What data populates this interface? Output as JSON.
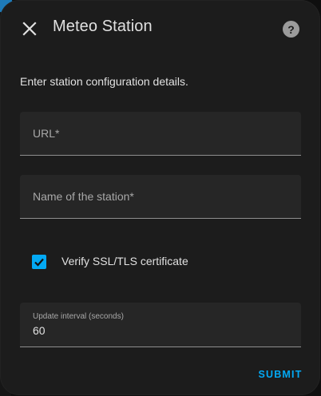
{
  "dialog": {
    "title": "Meteo Station",
    "description": "Enter station configuration details.",
    "close_icon": "close-icon",
    "help_icon": "help-circle-icon",
    "help_glyph": "?"
  },
  "form": {
    "url": {
      "label": "URL*",
      "value": ""
    },
    "station_name": {
      "label": "Name of the station*",
      "value": ""
    },
    "verify_ssl": {
      "label": "Verify SSL/TLS certificate",
      "checked": true,
      "icon": "checkmark-icon"
    },
    "update_interval": {
      "label": "Update interval (seconds)",
      "value": "60"
    }
  },
  "actions": {
    "submit_label": "SUBMIT"
  },
  "colors": {
    "accent": "#03a9f4",
    "dialog_bg": "#1c1c1c",
    "field_bg": "#262626",
    "text_primary": "#e1e1e1",
    "text_secondary": "#a8a8a8"
  }
}
